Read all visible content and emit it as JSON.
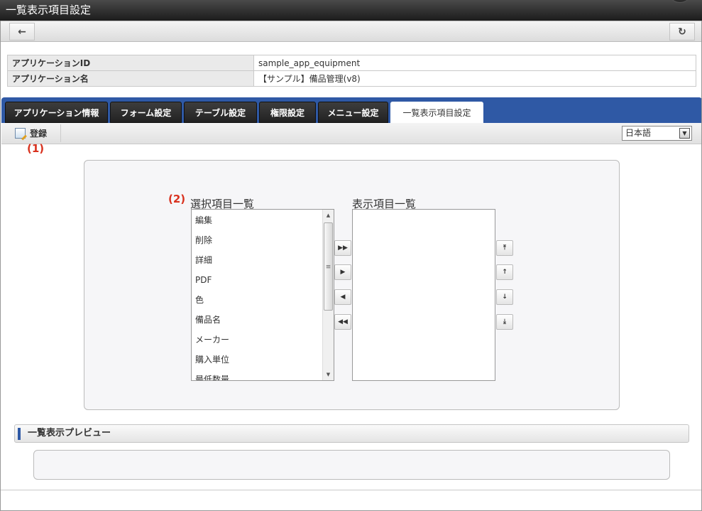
{
  "window": {
    "title": "一覧表示項目設定"
  },
  "nav": {
    "back_icon": "back-arrow-icon",
    "reload_icon": "reload-icon"
  },
  "info": {
    "app_id_label": "アプリケーションID",
    "app_id_value": "sample_app_equipment",
    "app_name_label": "アプリケーション名",
    "app_name_value": "【サンプル】備品管理(v8)"
  },
  "tabs": [
    {
      "label": "アプリケーション情報",
      "active": false
    },
    {
      "label": "フォーム設定",
      "active": false
    },
    {
      "label": "テーブル設定",
      "active": false
    },
    {
      "label": "権限設定",
      "active": false
    },
    {
      "label": "メニュー設定",
      "active": false
    },
    {
      "label": "一覧表示項目設定",
      "active": true
    }
  ],
  "toolbar": {
    "register_label": "登録",
    "language": "日本語"
  },
  "annotations": {
    "a1": "(1)",
    "a2": "(2)"
  },
  "selectable": {
    "title": "選択項目一覧",
    "items": [
      "編集",
      "削除",
      "詳細",
      "PDF",
      "色",
      "備品名",
      "メーカー",
      "購入単位",
      "最低数量"
    ]
  },
  "display": {
    "title": "表示項目一覧",
    "items": []
  },
  "transfer_buttons": [
    "add-all",
    "add-one",
    "remove-one",
    "remove-all"
  ],
  "order_buttons": [
    "move-top",
    "move-up",
    "move-down",
    "move-bottom"
  ],
  "preview": {
    "title": "一覧表示プレビュー"
  },
  "colors": {
    "tab_bar": "#2f59a5",
    "title_bar": "#1c1c1c",
    "annotation": "#d9321f"
  }
}
